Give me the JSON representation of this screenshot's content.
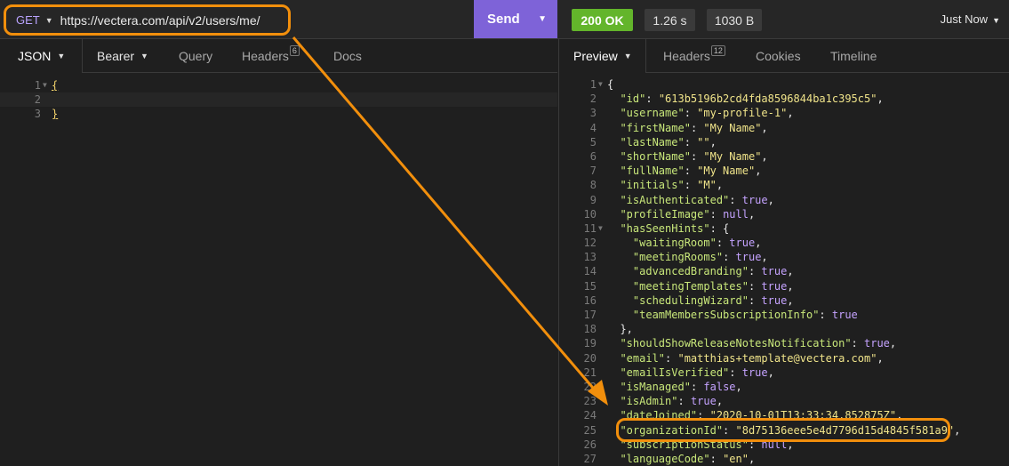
{
  "request": {
    "method": "GET",
    "url": "https://vectera.com/api/v2/users/me/",
    "send_label": "Send"
  },
  "response_meta": {
    "status": "200 OK",
    "time": "1.26 s",
    "size": "1030 B",
    "history": "Just Now"
  },
  "request_tabs": [
    {
      "label": "JSON"
    },
    {
      "label": "Bearer"
    },
    {
      "label": "Query"
    },
    {
      "label": "Headers",
      "badge": "6"
    },
    {
      "label": "Docs"
    }
  ],
  "response_tabs": [
    {
      "label": "Preview"
    },
    {
      "label": "Headers",
      "badge": "12"
    },
    {
      "label": "Cookies"
    },
    {
      "label": "Timeline"
    }
  ],
  "request_body": [
    {
      "n": "1",
      "text": "{"
    },
    {
      "n": "2",
      "text": ""
    },
    {
      "n": "3",
      "text": "}"
    }
  ],
  "response_body": [
    {
      "n": "1",
      "fold": true,
      "tokens": [
        [
          "p",
          "{"
        ]
      ]
    },
    {
      "n": "2",
      "tokens": [
        [
          "p",
          "  "
        ],
        [
          "k",
          "\"id\""
        ],
        [
          "p",
          ": "
        ],
        [
          "s",
          "\"613b5196b2cd4fda8596844ba1c395c5\""
        ],
        [
          "p",
          ","
        ]
      ]
    },
    {
      "n": "3",
      "tokens": [
        [
          "p",
          "  "
        ],
        [
          "k",
          "\"username\""
        ],
        [
          "p",
          ": "
        ],
        [
          "s",
          "\"my-profile-1\""
        ],
        [
          "p",
          ","
        ]
      ]
    },
    {
      "n": "4",
      "tokens": [
        [
          "p",
          "  "
        ],
        [
          "k",
          "\"firstName\""
        ],
        [
          "p",
          ": "
        ],
        [
          "s",
          "\"My Name\""
        ],
        [
          "p",
          ","
        ]
      ]
    },
    {
      "n": "5",
      "tokens": [
        [
          "p",
          "  "
        ],
        [
          "k",
          "\"lastName\""
        ],
        [
          "p",
          ": "
        ],
        [
          "s",
          "\"\""
        ],
        [
          "p",
          ","
        ]
      ]
    },
    {
      "n": "6",
      "tokens": [
        [
          "p",
          "  "
        ],
        [
          "k",
          "\"shortName\""
        ],
        [
          "p",
          ": "
        ],
        [
          "s",
          "\"My Name\""
        ],
        [
          "p",
          ","
        ]
      ]
    },
    {
      "n": "7",
      "tokens": [
        [
          "p",
          "  "
        ],
        [
          "k",
          "\"fullName\""
        ],
        [
          "p",
          ": "
        ],
        [
          "s",
          "\"My Name\""
        ],
        [
          "p",
          ","
        ]
      ]
    },
    {
      "n": "8",
      "tokens": [
        [
          "p",
          "  "
        ],
        [
          "k",
          "\"initials\""
        ],
        [
          "p",
          ": "
        ],
        [
          "s",
          "\"M\""
        ],
        [
          "p",
          ","
        ]
      ]
    },
    {
      "n": "9",
      "tokens": [
        [
          "p",
          "  "
        ],
        [
          "k",
          "\"isAuthenticated\""
        ],
        [
          "p",
          ": "
        ],
        [
          "v",
          "true"
        ],
        [
          "p",
          ","
        ]
      ]
    },
    {
      "n": "10",
      "tokens": [
        [
          "p",
          "  "
        ],
        [
          "k",
          "\"profileImage\""
        ],
        [
          "p",
          ": "
        ],
        [
          "v",
          "null"
        ],
        [
          "p",
          ","
        ]
      ]
    },
    {
      "n": "11",
      "fold": true,
      "tokens": [
        [
          "p",
          "  "
        ],
        [
          "k",
          "\"hasSeenHints\""
        ],
        [
          "p",
          ": {"
        ]
      ]
    },
    {
      "n": "12",
      "tokens": [
        [
          "p",
          "    "
        ],
        [
          "k",
          "\"waitingRoom\""
        ],
        [
          "p",
          ": "
        ],
        [
          "v",
          "true"
        ],
        [
          "p",
          ","
        ]
      ]
    },
    {
      "n": "13",
      "tokens": [
        [
          "p",
          "    "
        ],
        [
          "k",
          "\"meetingRooms\""
        ],
        [
          "p",
          ": "
        ],
        [
          "v",
          "true"
        ],
        [
          "p",
          ","
        ]
      ]
    },
    {
      "n": "14",
      "tokens": [
        [
          "p",
          "    "
        ],
        [
          "k",
          "\"advancedBranding\""
        ],
        [
          "p",
          ": "
        ],
        [
          "v",
          "true"
        ],
        [
          "p",
          ","
        ]
      ]
    },
    {
      "n": "15",
      "tokens": [
        [
          "p",
          "    "
        ],
        [
          "k",
          "\"meetingTemplates\""
        ],
        [
          "p",
          ": "
        ],
        [
          "v",
          "true"
        ],
        [
          "p",
          ","
        ]
      ]
    },
    {
      "n": "16",
      "tokens": [
        [
          "p",
          "    "
        ],
        [
          "k",
          "\"schedulingWizard\""
        ],
        [
          "p",
          ": "
        ],
        [
          "v",
          "true"
        ],
        [
          "p",
          ","
        ]
      ]
    },
    {
      "n": "17",
      "tokens": [
        [
          "p",
          "    "
        ],
        [
          "k",
          "\"teamMembersSubscriptionInfo\""
        ],
        [
          "p",
          ": "
        ],
        [
          "v",
          "true"
        ]
      ]
    },
    {
      "n": "18",
      "tokens": [
        [
          "p",
          "  },"
        ]
      ]
    },
    {
      "n": "19",
      "tokens": [
        [
          "p",
          "  "
        ],
        [
          "k",
          "\"shouldShowReleaseNotesNotification\""
        ],
        [
          "p",
          ": "
        ],
        [
          "v",
          "true"
        ],
        [
          "p",
          ","
        ]
      ]
    },
    {
      "n": "20",
      "tokens": [
        [
          "p",
          "  "
        ],
        [
          "k",
          "\"email\""
        ],
        [
          "p",
          ": "
        ],
        [
          "s",
          "\"matthias+template@vectera.com\""
        ],
        [
          "p",
          ","
        ]
      ]
    },
    {
      "n": "21",
      "tokens": [
        [
          "p",
          "  "
        ],
        [
          "k",
          "\"emailIsVerified\""
        ],
        [
          "p",
          ": "
        ],
        [
          "v",
          "true"
        ],
        [
          "p",
          ","
        ]
      ]
    },
    {
      "n": "22",
      "tokens": [
        [
          "p",
          "  "
        ],
        [
          "k",
          "\"isManaged\""
        ],
        [
          "p",
          ": "
        ],
        [
          "v",
          "false"
        ],
        [
          "p",
          ","
        ]
      ]
    },
    {
      "n": "23",
      "tokens": [
        [
          "p",
          "  "
        ],
        [
          "k",
          "\"isAdmin\""
        ],
        [
          "p",
          ": "
        ],
        [
          "v",
          "true"
        ],
        [
          "p",
          ","
        ]
      ]
    },
    {
      "n": "24",
      "tokens": [
        [
          "p",
          "  "
        ],
        [
          "k",
          "\"dateJoined\""
        ],
        [
          "p",
          ": "
        ],
        [
          "s",
          "\"2020-10-01T13:33:34.852875Z\""
        ],
        [
          "p",
          ","
        ]
      ]
    },
    {
      "n": "25",
      "tokens": [
        [
          "p",
          "  "
        ],
        [
          "k",
          "\"organizationId\""
        ],
        [
          "p",
          ": "
        ],
        [
          "s",
          "\"8d75136eee5e4d7796d15d4845f581a9\""
        ],
        [
          "p",
          ","
        ]
      ]
    },
    {
      "n": "26",
      "tokens": [
        [
          "p",
          "  "
        ],
        [
          "k",
          "\"subscriptionStatus\""
        ],
        [
          "p",
          ": "
        ],
        [
          "v",
          "null"
        ],
        [
          "p",
          ","
        ]
      ]
    },
    {
      "n": "27",
      "tokens": [
        [
          "p",
          "  "
        ],
        [
          "k",
          "\"languageCode\""
        ],
        [
          "p",
          ": "
        ],
        [
          "s",
          "\"en\""
        ],
        [
          "p",
          ","
        ]
      ]
    }
  ],
  "icons": {
    "dropdown": "caret-down-icon",
    "fold": "fold-arrow-icon"
  },
  "colors": {
    "accent": "#7e63d8",
    "status_ok": "#63b52b",
    "annotation": "#f28f0c",
    "json_key": "#c8e77a",
    "json_string": "#f0e48a",
    "json_literal": "#c5a3ff"
  }
}
